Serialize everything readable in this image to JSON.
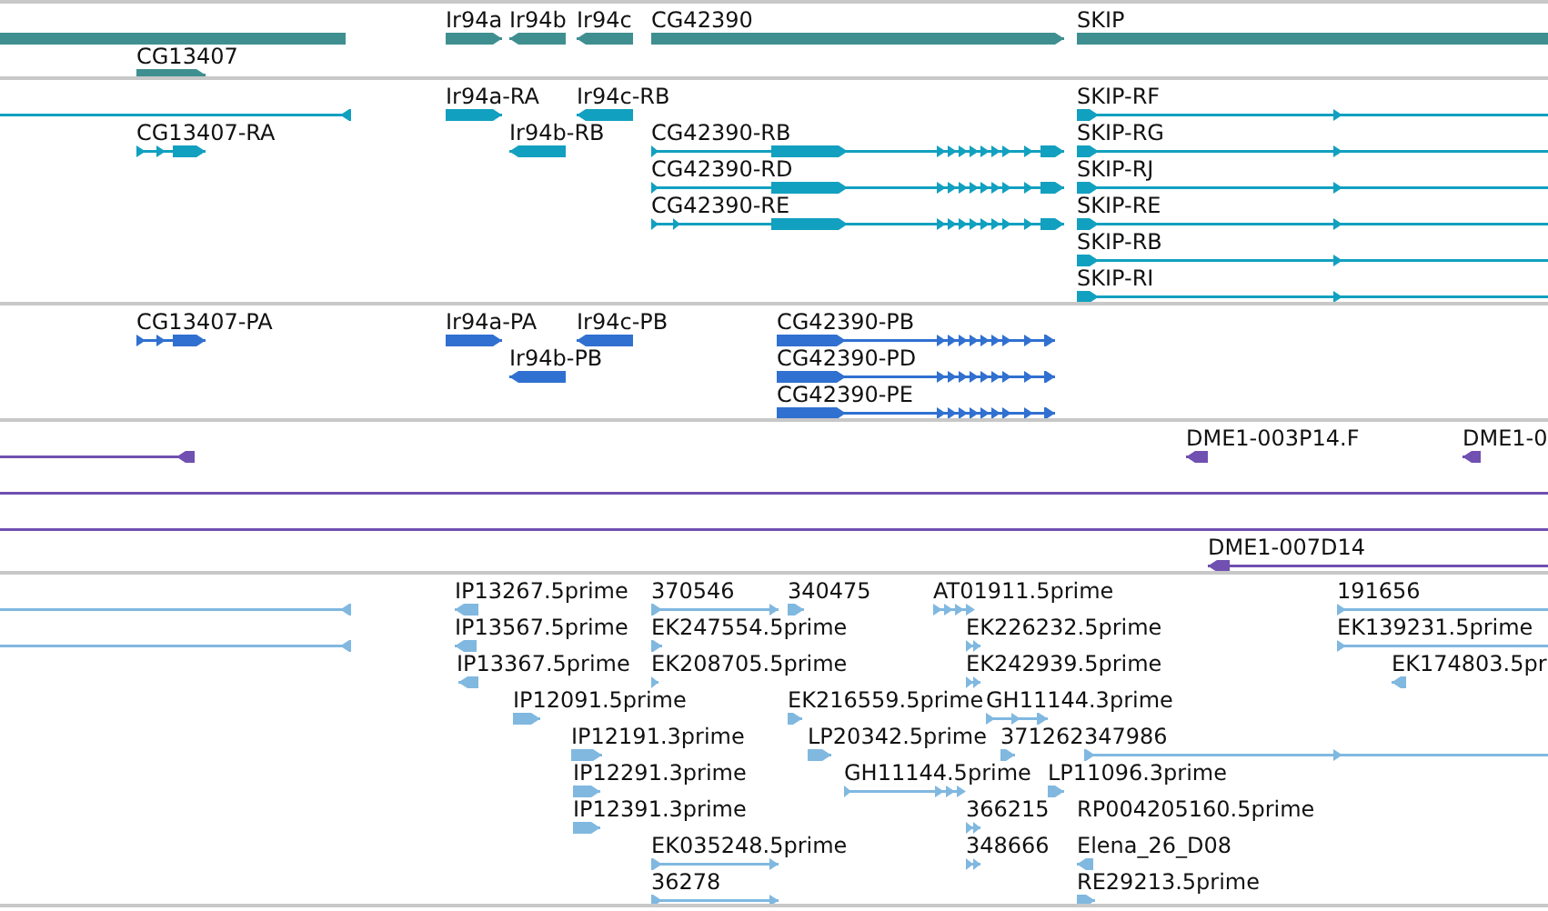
{
  "tracks": [
    {
      "color": "#3f8f91",
      "features": [
        {
          "kind": "plain"
        },
        {
          "label": "CG13407",
          "kind": "forward"
        },
        {
          "label": "Ir94a",
          "kind": "forward"
        },
        {
          "label": "Ir94b",
          "kind": "reverse"
        },
        {
          "label": "Ir94c",
          "kind": "reverse"
        },
        {
          "label": "CG42390",
          "kind": "forward"
        },
        {
          "label": "SKIP",
          "kind": "plain"
        }
      ]
    },
    {
      "color": "#12a0c0",
      "features": [
        {
          "kind": "reverse"
        },
        {
          "label": "Ir94a-RA",
          "kind": "forward"
        },
        {
          "label": "Ir94c-RB",
          "kind": "reverse"
        },
        {
          "label": "CG13407-RA",
          "kind": "forward"
        },
        {
          "label": "Ir94b-RB",
          "kind": "reverse"
        },
        {
          "label": "CG42390-RB",
          "kind": "forward"
        },
        {
          "label": "CG42390-RD",
          "kind": "forward"
        },
        {
          "label": "CG42390-RE",
          "kind": "forward"
        },
        {
          "label": "SKIP-RF",
          "kind": "forward"
        },
        {
          "label": "SKIP-RG",
          "kind": "forward"
        },
        {
          "label": "SKIP-RJ",
          "kind": "forward"
        },
        {
          "label": "SKIP-RE",
          "kind": "forward"
        },
        {
          "label": "SKIP-RB",
          "kind": "forward"
        },
        {
          "label": "SKIP-RI",
          "kind": "forward"
        }
      ]
    },
    {
      "color": "#3070d0",
      "features": [
        {
          "label": "CG13407-PA",
          "kind": "forward"
        },
        {
          "label": "Ir94a-PA",
          "kind": "forward"
        },
        {
          "label": "Ir94c-PB",
          "kind": "reverse"
        },
        {
          "label": "Ir94b-PB",
          "kind": "reverse"
        },
        {
          "label": "CG42390-PB",
          "kind": "forward"
        },
        {
          "label": "CG42390-PD",
          "kind": "forward"
        },
        {
          "label": "CG42390-PE",
          "kind": "forward"
        }
      ]
    },
    {
      "color": "#7050b0",
      "features": [
        {
          "kind": "reverse"
        },
        {
          "label": "DME1-003P14.F",
          "kind": "reverse"
        },
        {
          "label": "DME1-0",
          "kind": "reverse"
        },
        {
          "kind": "line"
        },
        {
          "kind": "line"
        },
        {
          "label": "DME1-007D14",
          "kind": "reverse"
        }
      ]
    },
    {
      "color": "#80b8e0",
      "features": [
        {
          "kind": "reverse"
        },
        {
          "label": "IP13267.5prime",
          "kind": "reverse"
        },
        {
          "label": "370546",
          "kind": "forward"
        },
        {
          "label": "340475",
          "kind": "forward"
        },
        {
          "label": "AT01911.5prime",
          "kind": "forward"
        },
        {
          "label": "191656",
          "kind": "forward"
        },
        {
          "kind": "reverse"
        },
        {
          "label": "IP13567.5prime",
          "kind": "reverse"
        },
        {
          "label": "EK247554.5prime",
          "kind": "forward"
        },
        {
          "label": "EK226232.5prime",
          "kind": "forward"
        },
        {
          "label": "EK139231.5prime",
          "kind": "forward"
        },
        {
          "label": "IP13367.5prime",
          "kind": "reverse"
        },
        {
          "label": "EK208705.5prime",
          "kind": "forward"
        },
        {
          "label": "EK242939.5prime",
          "kind": "forward"
        },
        {
          "label": "EK174803.5pr",
          "kind": "reverse"
        },
        {
          "label": "IP12091.5prime",
          "kind": "forward"
        },
        {
          "label": "EK216559.5prime",
          "kind": "forward"
        },
        {
          "label": "GH11144.3prime",
          "kind": "forward"
        },
        {
          "label": "IP12191.3prime",
          "kind": "forward"
        },
        {
          "label": "LP20342.5prime",
          "kind": "forward"
        },
        {
          "label": "371262",
          "kind": "forward"
        },
        {
          "label": "347986",
          "kind": "forward"
        },
        {
          "label": "IP12291.3prime",
          "kind": "forward"
        },
        {
          "label": "GH11144.5prime",
          "kind": "forward"
        },
        {
          "label": "LP11096.3prime",
          "kind": "forward"
        },
        {
          "label": "IP12391.3prime",
          "kind": "forward"
        },
        {
          "label": "366215",
          "kind": "forward"
        },
        {
          "label": "RP004205160.5prime"
        },
        {
          "label": "EK035248.5prime",
          "kind": "forward"
        },
        {
          "label": "348666",
          "kind": "forward"
        },
        {
          "label": "Elena_26_D08",
          "kind": "reverse"
        },
        {
          "label": "36278",
          "kind": "forward"
        },
        {
          "label": "RE29213.5prime",
          "kind": "forward"
        }
      ]
    }
  ]
}
